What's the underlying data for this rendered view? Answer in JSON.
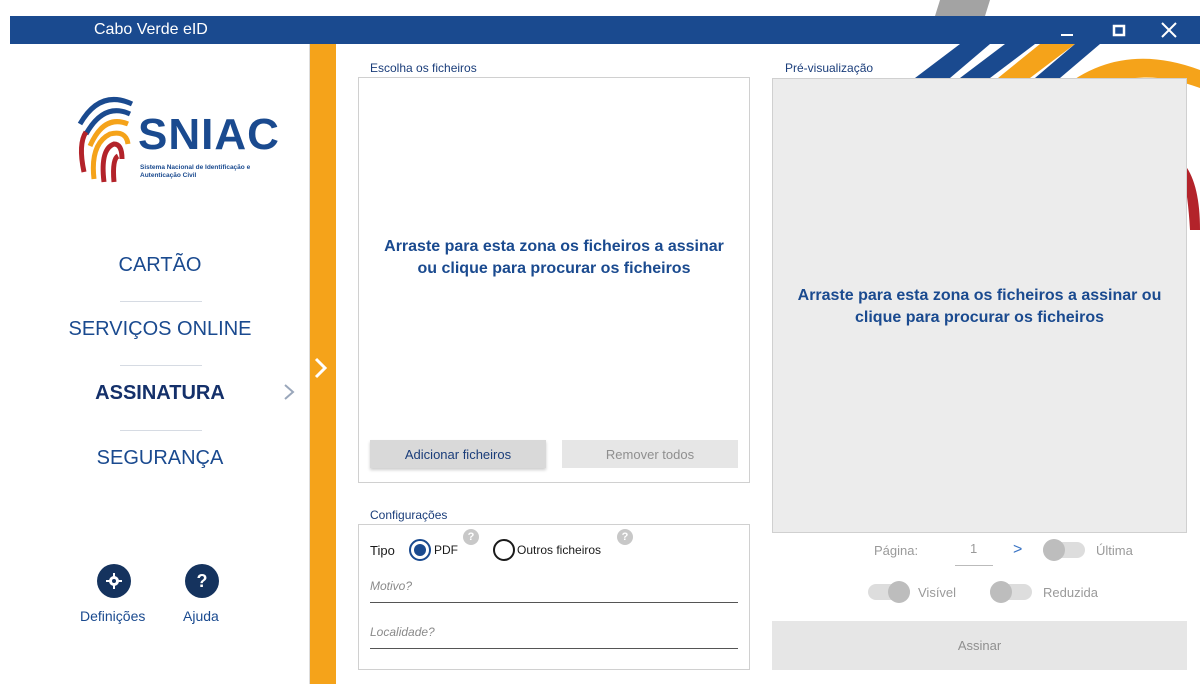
{
  "window": {
    "title": "Cabo Verde eID",
    "controls": [
      "minimize-icon",
      "maximize-icon",
      "close-icon"
    ]
  },
  "sidebar": {
    "logo": {
      "name": "SNIAC",
      "subtitle": "Sistema Nacional de Identificação e Autenticação Civil"
    },
    "nav": [
      {
        "label": "CARTÃO",
        "active": false
      },
      {
        "label": "SERVIÇOS ONLINE",
        "active": false
      },
      {
        "label": "ASSINATURA",
        "active": true
      },
      {
        "label": "SEGURANÇA",
        "active": false
      }
    ],
    "settings_label": "Definições",
    "help_label": "Ajuda"
  },
  "files": {
    "section_label": "Escolha os ficheiros",
    "drop_text_line1": "Arraste para esta zona os ficheiros a assinar",
    "drop_text_line2": "ou clique para procurar os ficheiros",
    "add_button": "Adicionar ficheiros",
    "remove_button": "Remover todos"
  },
  "config": {
    "section_label": "Configurações",
    "type_label": "Tipo",
    "pdf_option": "PDF",
    "other_option": "Outros ficheiros",
    "selected_type": "PDF",
    "reason_placeholder": "Motivo?",
    "location_placeholder": "Localidade?"
  },
  "preview": {
    "section_label": "Pré-visualização",
    "drop_text_line1": "Arraste para esta zona os ficheiros a assinar ou",
    "drop_text_line2": "clique para procurar os ficheiros",
    "page_label": "Página:",
    "page_value": "1",
    "next_symbol": ">",
    "last_label": "Última",
    "visible_label": "Visível",
    "reduced_label": "Reduzida",
    "sign_button": "Assinar"
  },
  "colors": {
    "brand_blue": "#1a4a8f",
    "accent_orange": "#f5a31a",
    "accent_red": "#b3232a"
  }
}
